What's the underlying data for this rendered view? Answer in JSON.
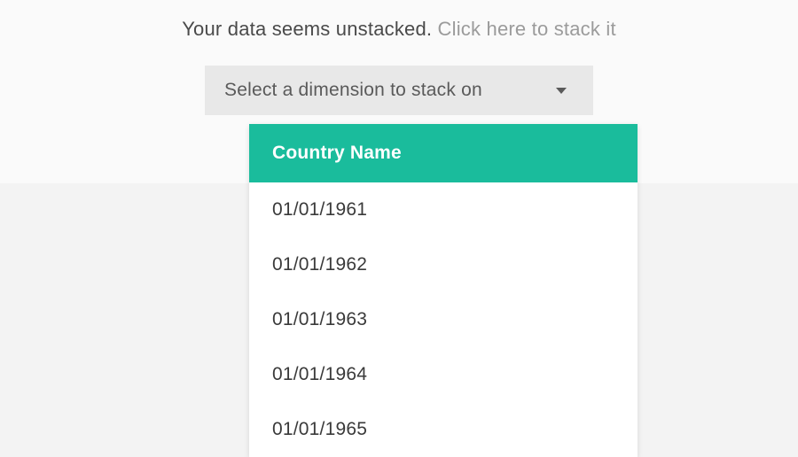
{
  "message": {
    "text": "Your data seems unstacked. ",
    "link_text": "Click here to stack it"
  },
  "dropdown": {
    "placeholder": "Select a dimension to stack on",
    "selected_index": 0,
    "options": [
      "Country Name",
      "01/01/1961",
      "01/01/1962",
      "01/01/1963",
      "01/01/1964",
      "01/01/1965"
    ]
  },
  "colors": {
    "accent": "#1abc9c"
  }
}
